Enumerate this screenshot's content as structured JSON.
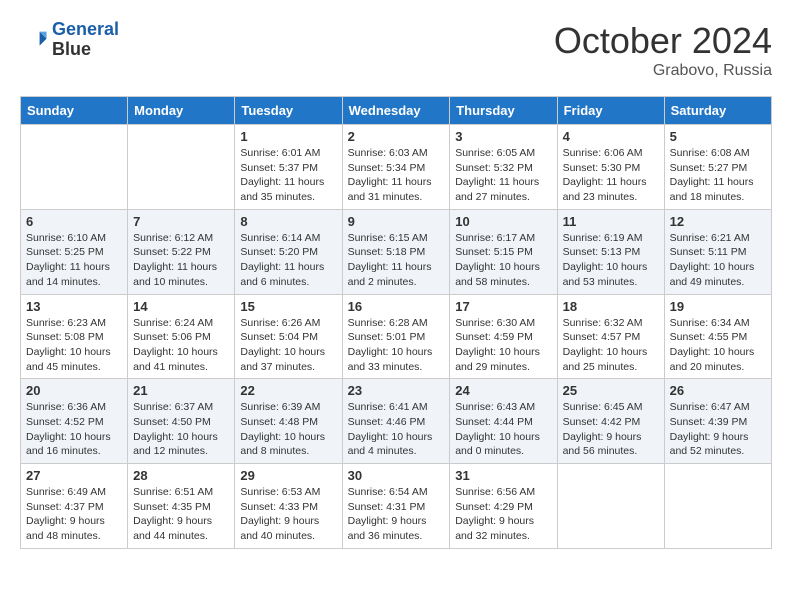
{
  "header": {
    "logo_line1": "General",
    "logo_line2": "Blue",
    "month": "October 2024",
    "location": "Grabovo, Russia"
  },
  "weekdays": [
    "Sunday",
    "Monday",
    "Tuesday",
    "Wednesday",
    "Thursday",
    "Friday",
    "Saturday"
  ],
  "weeks": [
    [
      {
        "day": "",
        "info": ""
      },
      {
        "day": "",
        "info": ""
      },
      {
        "day": "1",
        "info": "Sunrise: 6:01 AM\nSunset: 5:37 PM\nDaylight: 11 hours and 35 minutes."
      },
      {
        "day": "2",
        "info": "Sunrise: 6:03 AM\nSunset: 5:34 PM\nDaylight: 11 hours and 31 minutes."
      },
      {
        "day": "3",
        "info": "Sunrise: 6:05 AM\nSunset: 5:32 PM\nDaylight: 11 hours and 27 minutes."
      },
      {
        "day": "4",
        "info": "Sunrise: 6:06 AM\nSunset: 5:30 PM\nDaylight: 11 hours and 23 minutes."
      },
      {
        "day": "5",
        "info": "Sunrise: 6:08 AM\nSunset: 5:27 PM\nDaylight: 11 hours and 18 minutes."
      }
    ],
    [
      {
        "day": "6",
        "info": "Sunrise: 6:10 AM\nSunset: 5:25 PM\nDaylight: 11 hours and 14 minutes."
      },
      {
        "day": "7",
        "info": "Sunrise: 6:12 AM\nSunset: 5:22 PM\nDaylight: 11 hours and 10 minutes."
      },
      {
        "day": "8",
        "info": "Sunrise: 6:14 AM\nSunset: 5:20 PM\nDaylight: 11 hours and 6 minutes."
      },
      {
        "day": "9",
        "info": "Sunrise: 6:15 AM\nSunset: 5:18 PM\nDaylight: 11 hours and 2 minutes."
      },
      {
        "day": "10",
        "info": "Sunrise: 6:17 AM\nSunset: 5:15 PM\nDaylight: 10 hours and 58 minutes."
      },
      {
        "day": "11",
        "info": "Sunrise: 6:19 AM\nSunset: 5:13 PM\nDaylight: 10 hours and 53 minutes."
      },
      {
        "day": "12",
        "info": "Sunrise: 6:21 AM\nSunset: 5:11 PM\nDaylight: 10 hours and 49 minutes."
      }
    ],
    [
      {
        "day": "13",
        "info": "Sunrise: 6:23 AM\nSunset: 5:08 PM\nDaylight: 10 hours and 45 minutes."
      },
      {
        "day": "14",
        "info": "Sunrise: 6:24 AM\nSunset: 5:06 PM\nDaylight: 10 hours and 41 minutes."
      },
      {
        "day": "15",
        "info": "Sunrise: 6:26 AM\nSunset: 5:04 PM\nDaylight: 10 hours and 37 minutes."
      },
      {
        "day": "16",
        "info": "Sunrise: 6:28 AM\nSunset: 5:01 PM\nDaylight: 10 hours and 33 minutes."
      },
      {
        "day": "17",
        "info": "Sunrise: 6:30 AM\nSunset: 4:59 PM\nDaylight: 10 hours and 29 minutes."
      },
      {
        "day": "18",
        "info": "Sunrise: 6:32 AM\nSunset: 4:57 PM\nDaylight: 10 hours and 25 minutes."
      },
      {
        "day": "19",
        "info": "Sunrise: 6:34 AM\nSunset: 4:55 PM\nDaylight: 10 hours and 20 minutes."
      }
    ],
    [
      {
        "day": "20",
        "info": "Sunrise: 6:36 AM\nSunset: 4:52 PM\nDaylight: 10 hours and 16 minutes."
      },
      {
        "day": "21",
        "info": "Sunrise: 6:37 AM\nSunset: 4:50 PM\nDaylight: 10 hours and 12 minutes."
      },
      {
        "day": "22",
        "info": "Sunrise: 6:39 AM\nSunset: 4:48 PM\nDaylight: 10 hours and 8 minutes."
      },
      {
        "day": "23",
        "info": "Sunrise: 6:41 AM\nSunset: 4:46 PM\nDaylight: 10 hours and 4 minutes."
      },
      {
        "day": "24",
        "info": "Sunrise: 6:43 AM\nSunset: 4:44 PM\nDaylight: 10 hours and 0 minutes."
      },
      {
        "day": "25",
        "info": "Sunrise: 6:45 AM\nSunset: 4:42 PM\nDaylight: 9 hours and 56 minutes."
      },
      {
        "day": "26",
        "info": "Sunrise: 6:47 AM\nSunset: 4:39 PM\nDaylight: 9 hours and 52 minutes."
      }
    ],
    [
      {
        "day": "27",
        "info": "Sunrise: 6:49 AM\nSunset: 4:37 PM\nDaylight: 9 hours and 48 minutes."
      },
      {
        "day": "28",
        "info": "Sunrise: 6:51 AM\nSunset: 4:35 PM\nDaylight: 9 hours and 44 minutes."
      },
      {
        "day": "29",
        "info": "Sunrise: 6:53 AM\nSunset: 4:33 PM\nDaylight: 9 hours and 40 minutes."
      },
      {
        "day": "30",
        "info": "Sunrise: 6:54 AM\nSunset: 4:31 PM\nDaylight: 9 hours and 36 minutes."
      },
      {
        "day": "31",
        "info": "Sunrise: 6:56 AM\nSunset: 4:29 PM\nDaylight: 9 hours and 32 minutes."
      },
      {
        "day": "",
        "info": ""
      },
      {
        "day": "",
        "info": ""
      }
    ]
  ]
}
